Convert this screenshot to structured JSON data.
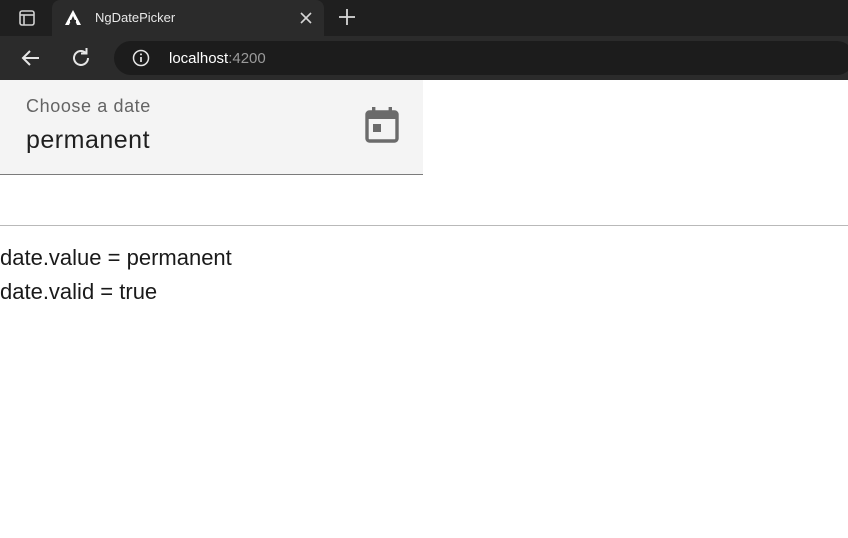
{
  "browser": {
    "tab_title": "NgDatePicker",
    "url_host": "localhost",
    "url_port": ":4200"
  },
  "icons": {
    "tab_actions": "tab-actions-icon",
    "favicon": "angular-icon",
    "close": "close-icon",
    "new_tab": "plus-icon",
    "back": "arrow-left-icon",
    "reload": "reload-icon",
    "site_info": "info-icon",
    "calendar": "calendar-icon"
  },
  "datepicker": {
    "label": "Choose a date",
    "value": "permanent"
  },
  "output": {
    "line1": "date.value = permanent",
    "line2": "date.valid = true"
  }
}
